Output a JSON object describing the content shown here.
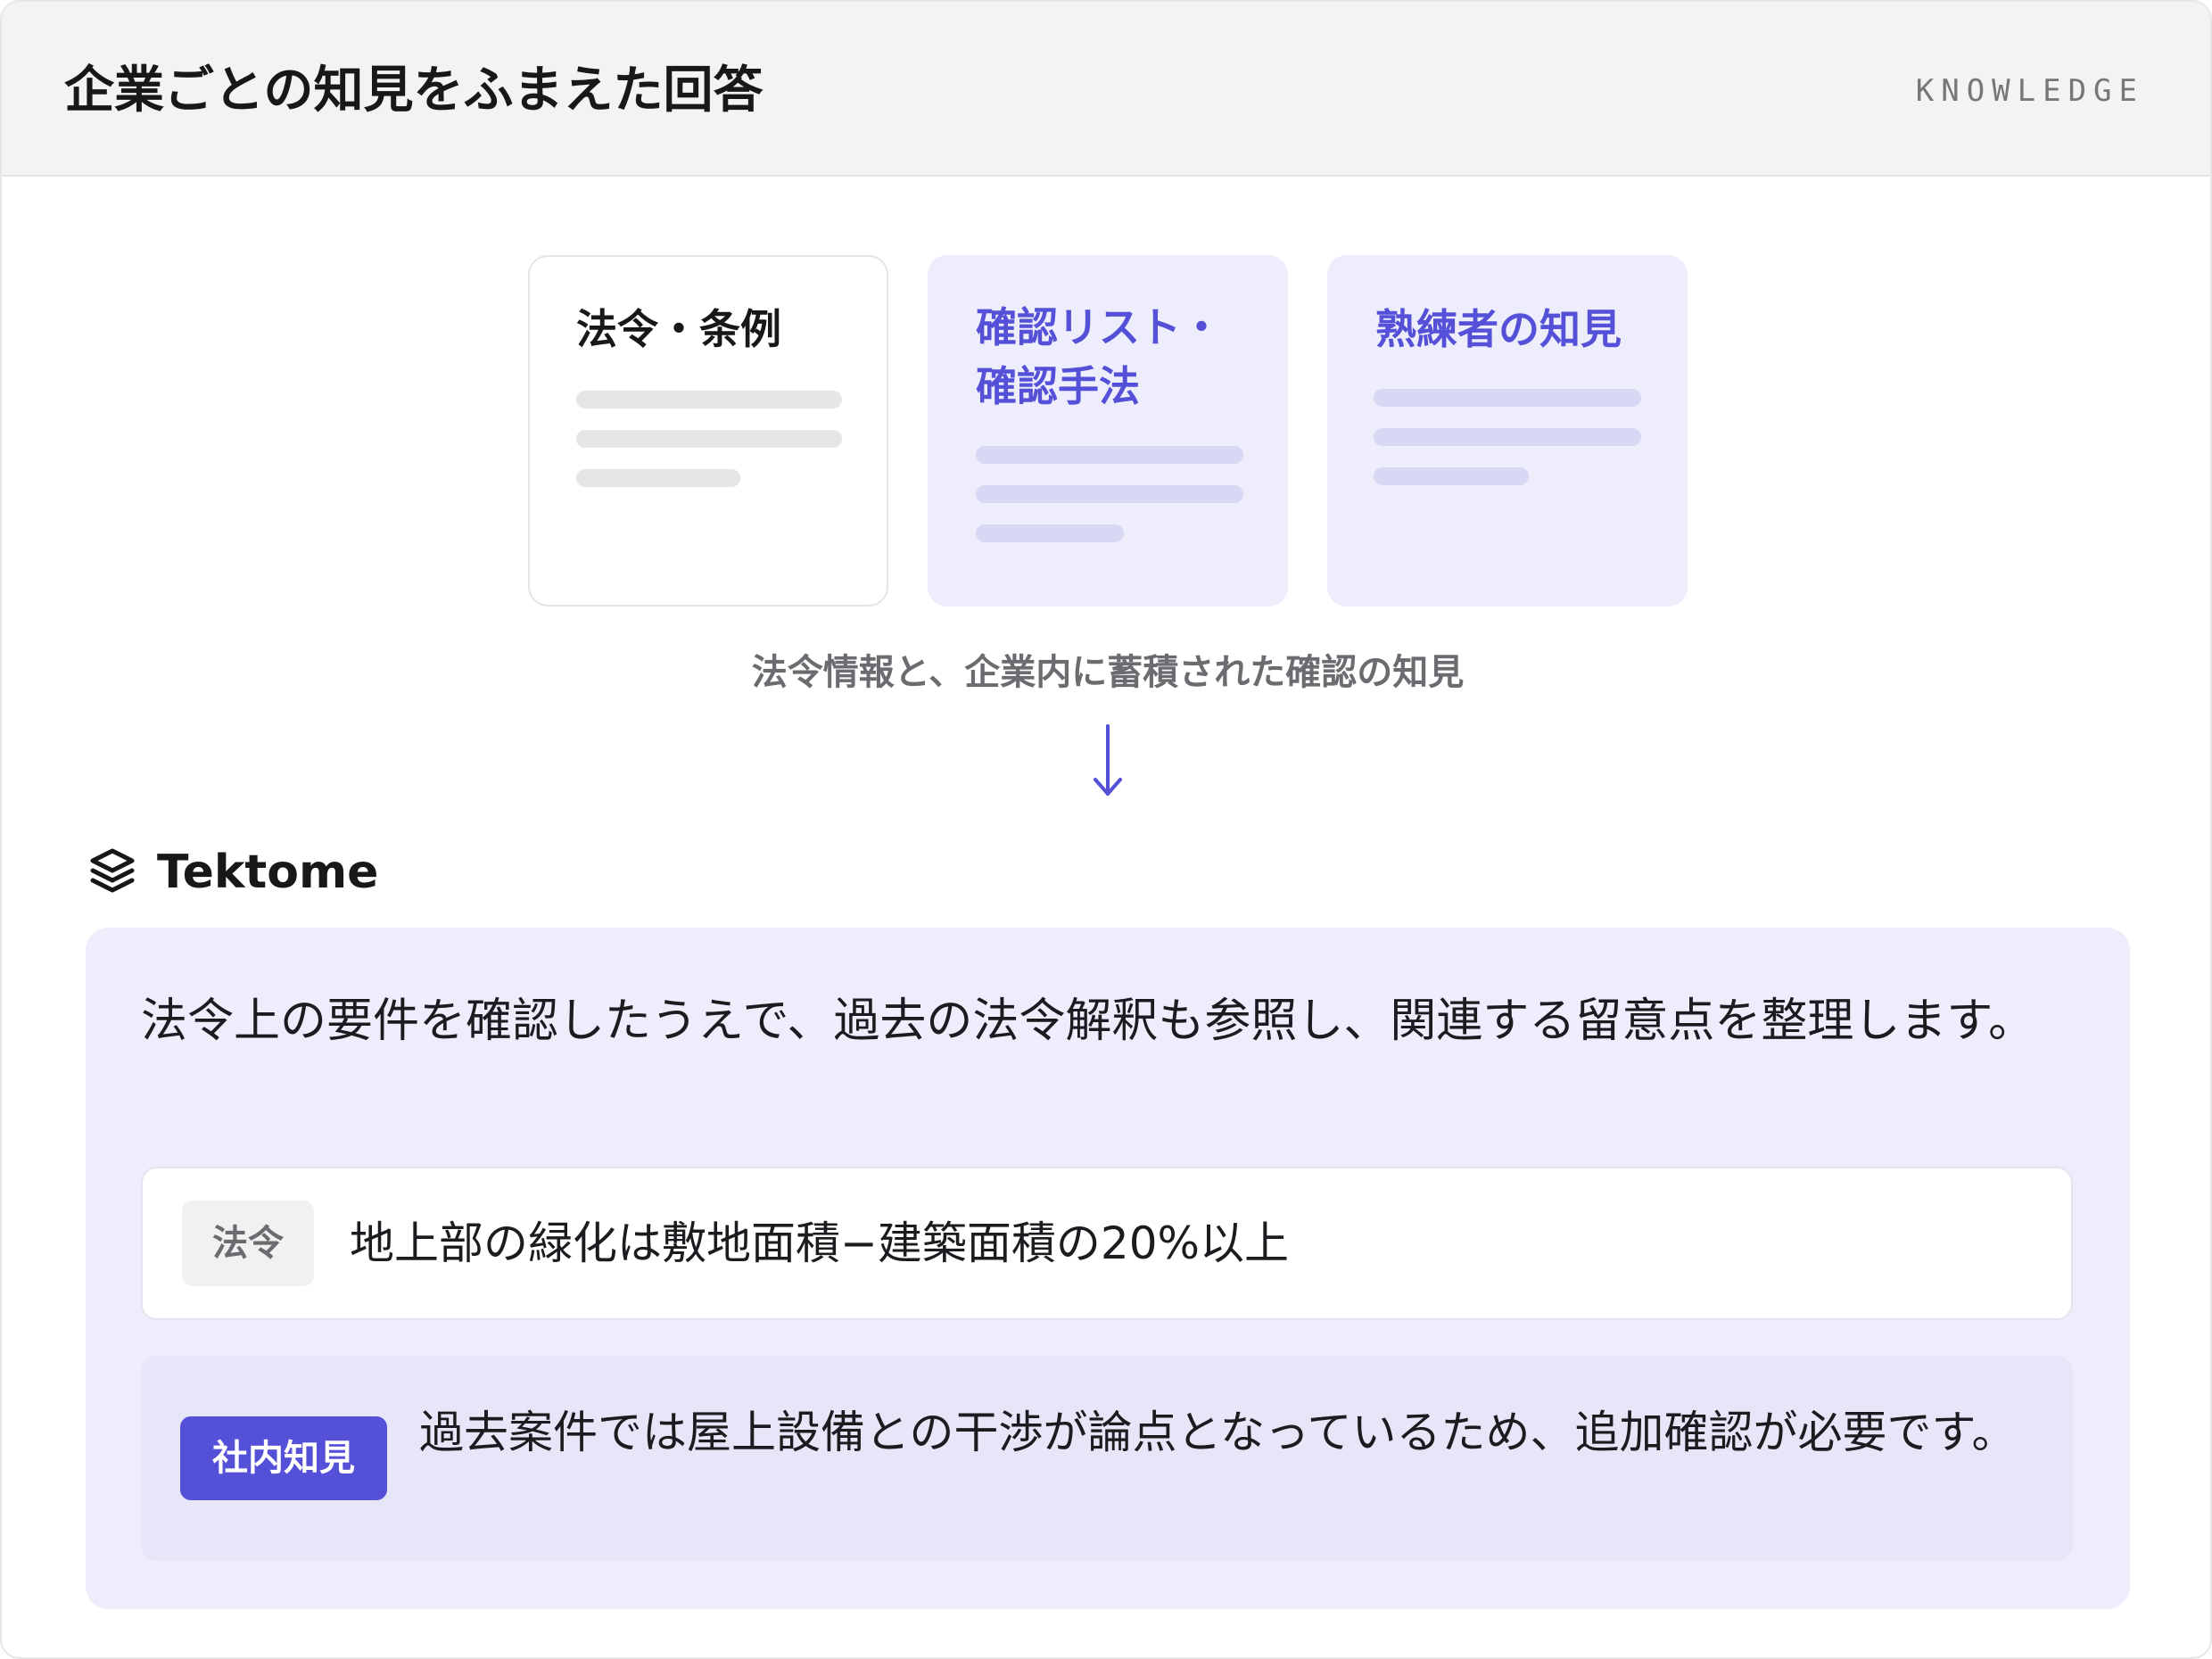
{
  "header": {
    "title": "企業ごとの知見をふまえた回答",
    "tag": "KNOWLEDGE"
  },
  "cards": [
    {
      "title": "法令・条例"
    },
    {
      "title_line1": "確認リスト・",
      "title_line2": "確認手法"
    },
    {
      "title": "熟練者の知見"
    }
  ],
  "caption": "法令情報と、企業内に蓄積された確認の知見",
  "arrow_icon": "down-arrow-icon",
  "brand": {
    "icon": "stacked-layers-icon",
    "name": "Tektome"
  },
  "answer": {
    "text": "法令上の要件を確認したうえで、過去の法令解釈も参照し、関連する留意点を整理します。",
    "items": [
      {
        "badge": "法令",
        "text": "地上部の緑化は敷地面積−建築面積の20%以上"
      },
      {
        "badge": "社内知見",
        "text": "過去案件では屋上設備との干渉が論点となっているため、追加確認が必要です。"
      }
    ]
  },
  "colors": {
    "accent": "#5450d8",
    "lavender": "#ededfb",
    "header_bg": "#f3f3f4"
  }
}
